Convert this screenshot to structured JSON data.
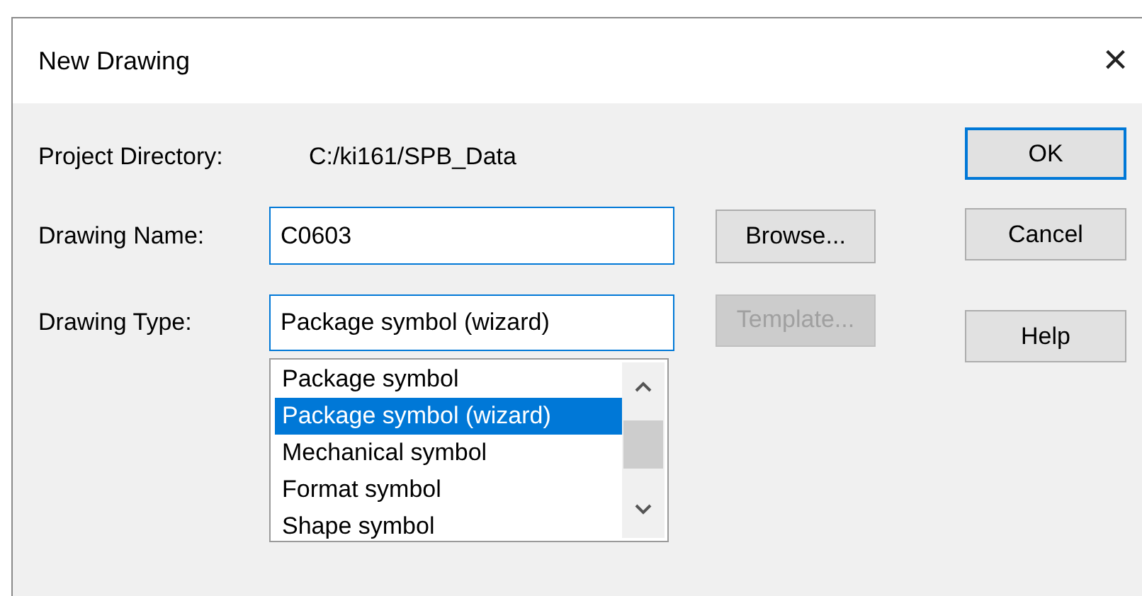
{
  "window": {
    "title": "New Drawing",
    "close": "×"
  },
  "project_directory": {
    "label": "Project Directory:",
    "value": "C:/ki161/SPB_Data"
  },
  "drawing_name": {
    "label": "Drawing Name:",
    "value": "C0603",
    "button": {
      "label": "Browse...",
      "disabled": false
    }
  },
  "drawing_type": {
    "label": "Drawing Type:",
    "value": "Package symbol (wizard)",
    "button": {
      "label": "Template...",
      "disabled": true
    },
    "options": [
      {
        "label": "Package symbol",
        "selected": false
      },
      {
        "label": "Package symbol (wizard)",
        "selected": true
      },
      {
        "label": "Mechanical symbol",
        "selected": false
      },
      {
        "label": "Format symbol",
        "selected": false
      },
      {
        "label": "Shape symbol",
        "selected": false
      }
    ]
  },
  "buttons": [
    {
      "label": "OK",
      "default": true
    },
    {
      "label": "Cancel",
      "default": false
    },
    {
      "label": "Help",
      "default": false
    }
  ]
}
